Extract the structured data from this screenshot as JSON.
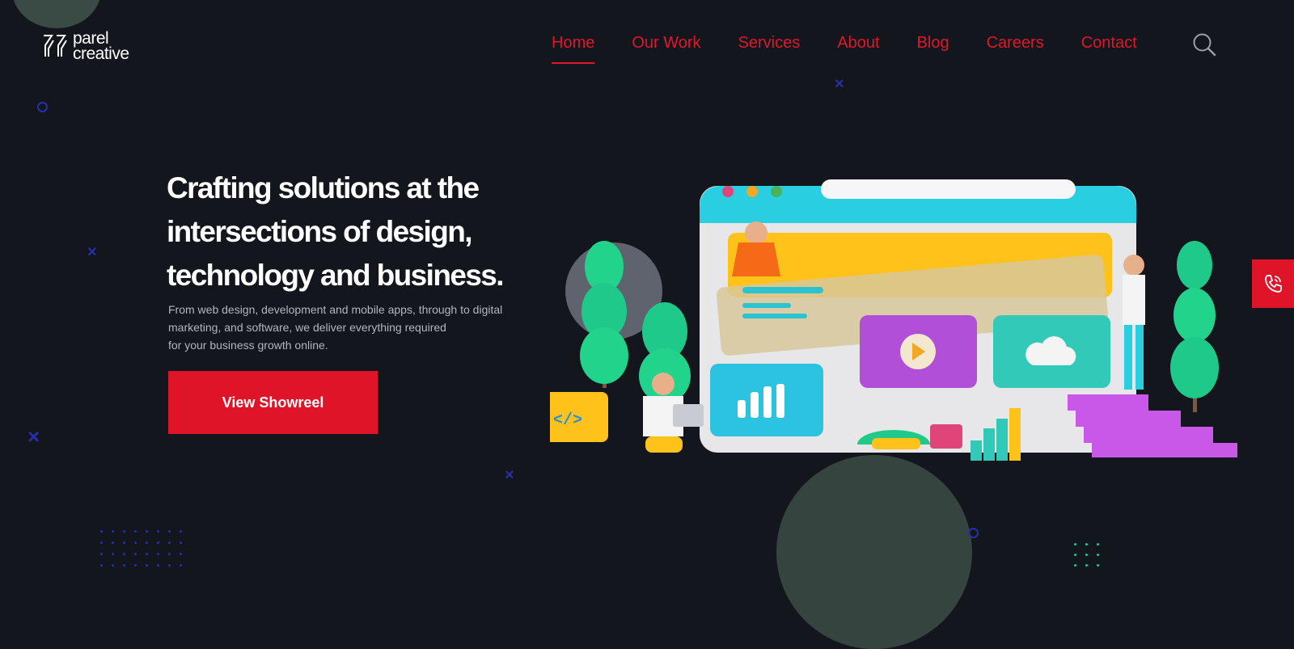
{
  "brand": {
    "line1": "parel",
    "line2": "creative"
  },
  "nav": {
    "items": [
      {
        "label": "Home",
        "active": true
      },
      {
        "label": "Our Work",
        "active": false
      },
      {
        "label": "Services",
        "active": false
      },
      {
        "label": "About",
        "active": false
      },
      {
        "label": "Blog",
        "active": false
      },
      {
        "label": "Careers",
        "active": false
      },
      {
        "label": "Contact",
        "active": false
      }
    ],
    "search_icon": "search-icon"
  },
  "hero": {
    "headline_lines": [
      "Crafting solutions at the",
      "intersections of design,",
      "technology and business."
    ],
    "description_lines": [
      "From web design, development and mobile apps, through to digital",
      "marketing, and software, we deliver everything required",
      "for your business growth online."
    ],
    "cta_label": "View Showreel"
  },
  "side_tab": {
    "icon": "phone-icon"
  },
  "colors": {
    "background": "#13161d",
    "accent": "#e0162b",
    "decor_blue": "#2530a8",
    "dot_green": "#1ec98a"
  }
}
